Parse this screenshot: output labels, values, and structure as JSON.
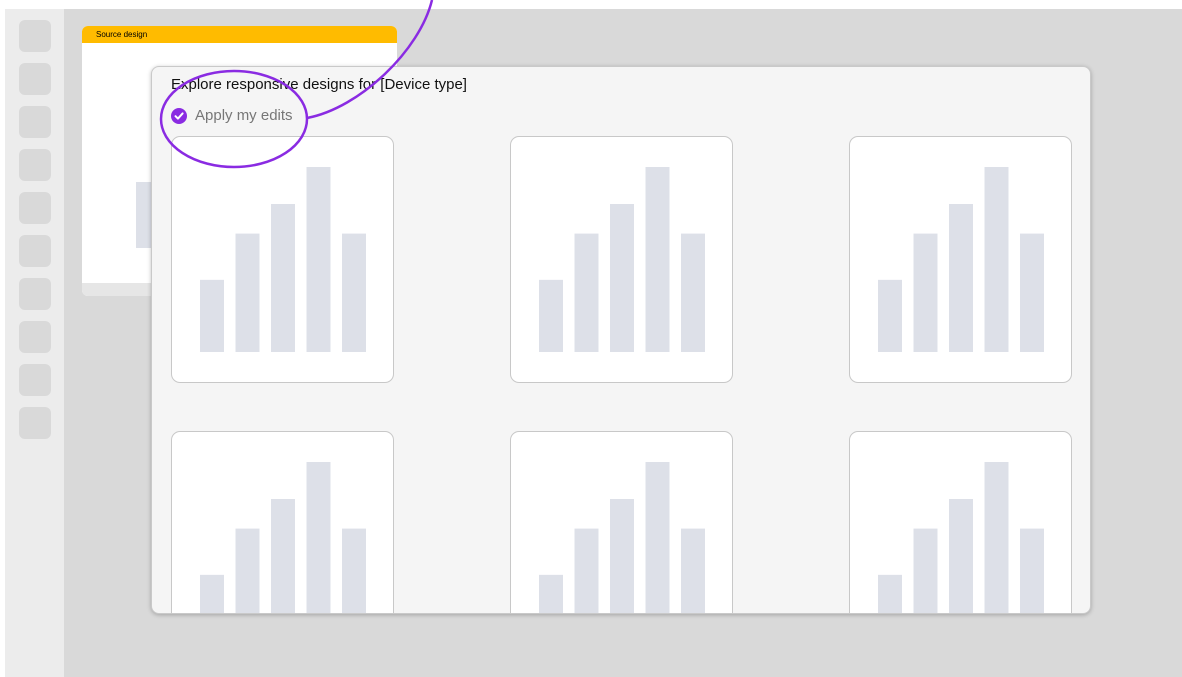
{
  "source_card": {
    "header": "Source design"
  },
  "dialog": {
    "title": "Explore responsive designs for [Device type]",
    "apply_label": "Apply my edits",
    "apply_checked": true
  },
  "design_card_bars": [
    {
      "value": 0.39,
      "color": "#dde0e8"
    },
    {
      "value": 0.64,
      "color": "#dde0e8"
    },
    {
      "value": 0.8,
      "color": "#dde0e8"
    },
    {
      "value": 1.0,
      "color": "#dde0e8"
    },
    {
      "value": 0.64,
      "color": "#dde0e8"
    }
  ],
  "colors": {
    "accent": "#8a2be2",
    "source_header": "#ffbb00"
  }
}
